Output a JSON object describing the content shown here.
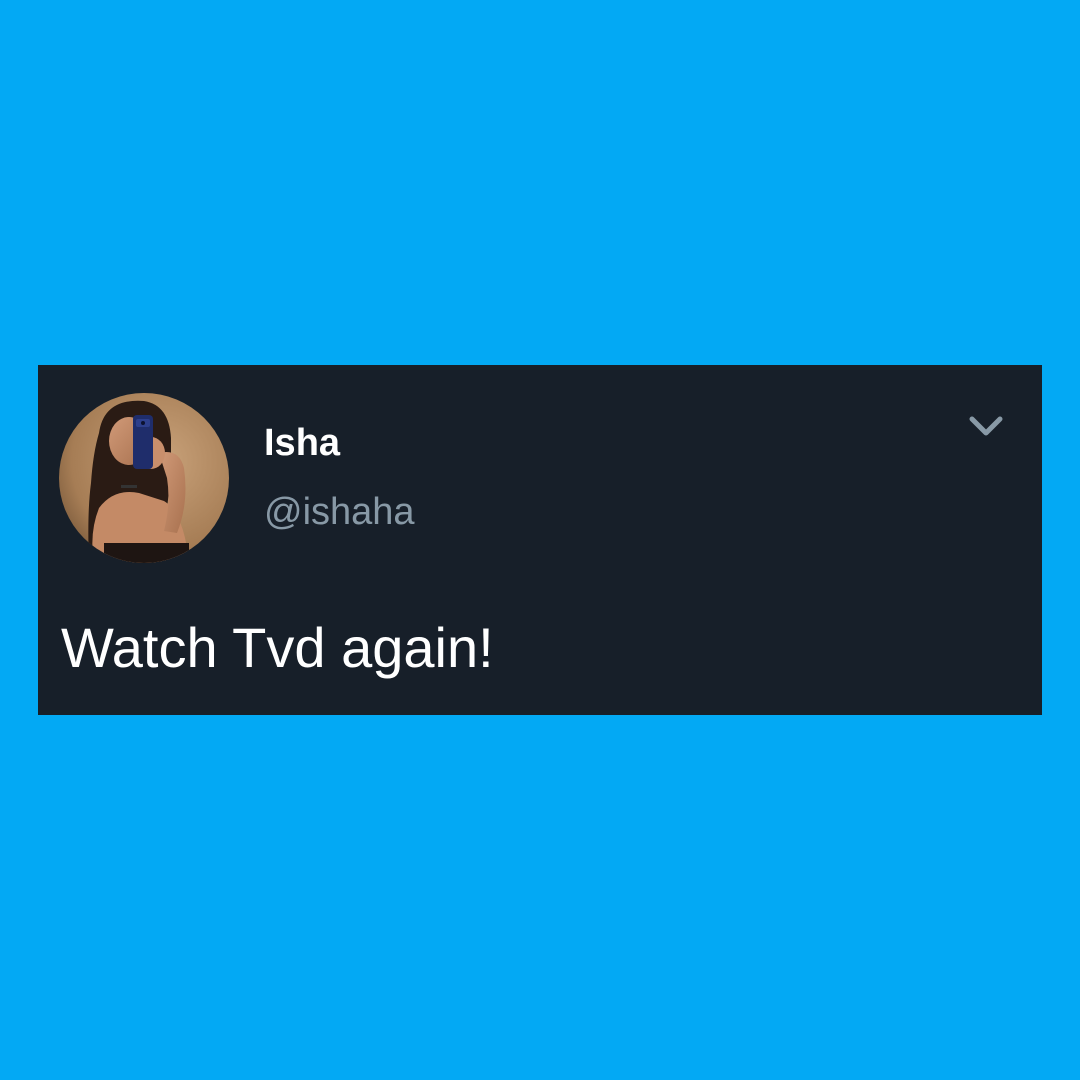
{
  "tweet": {
    "display_name": "Isha",
    "handle": "@ishaha",
    "text": "Watch Tvd again!",
    "avatar_icon": "profile-photo-avatar",
    "menu_icon": "chevron-down-icon"
  },
  "colors": {
    "background": "#03a9f4",
    "card": "#171f29",
    "name": "#ffffff",
    "handle": "#8899a6",
    "text": "#ffffff",
    "chevron": "#8899a6"
  }
}
